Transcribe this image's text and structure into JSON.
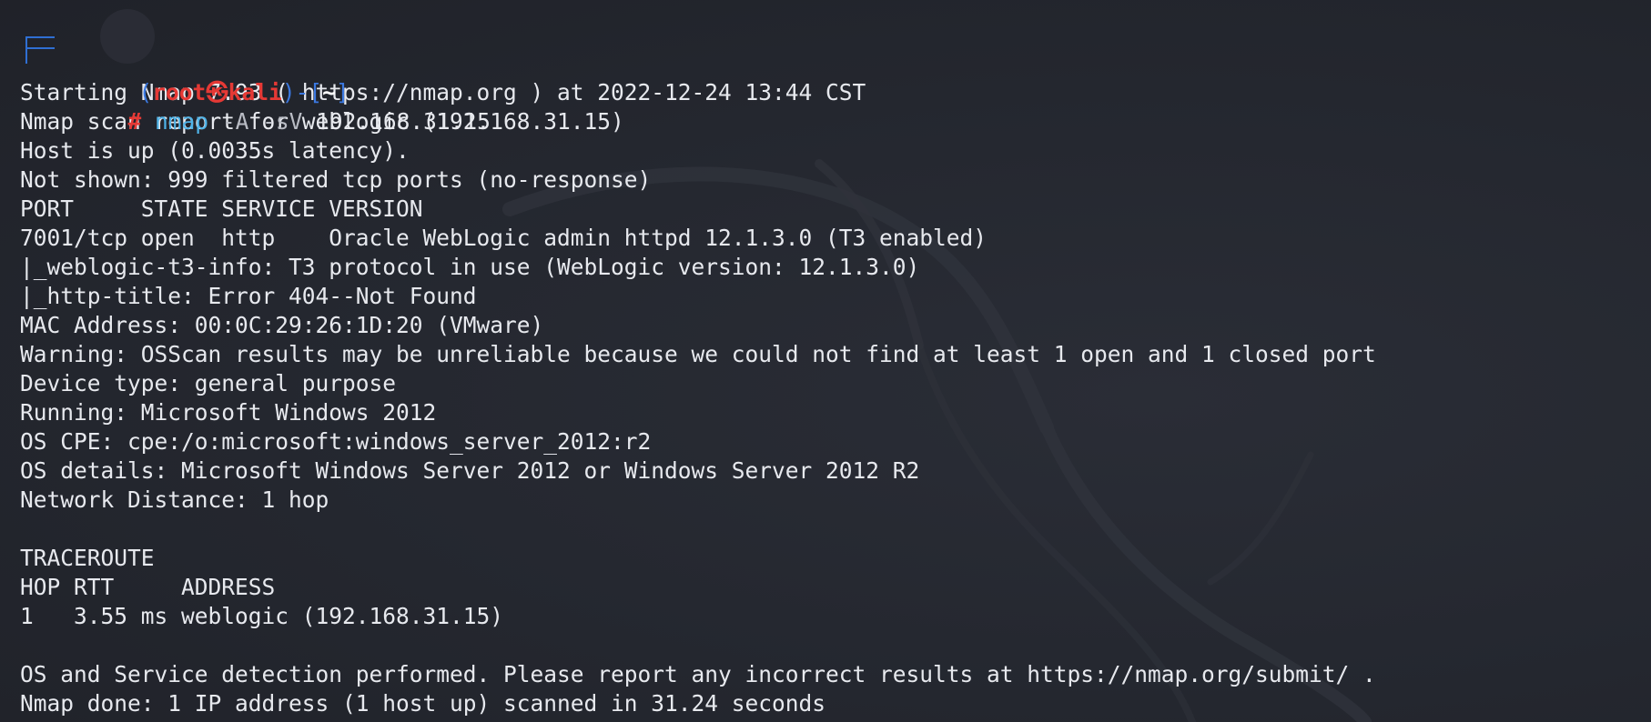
{
  "prompt": {
    "open_paren": "(",
    "user": "root",
    "at_symbol": "㉿",
    "host": "kali",
    "close_paren": ")",
    "dash": "-",
    "dir_open": "[",
    "dir": "~",
    "dir_close": "]",
    "hash": "#"
  },
  "command": {
    "program": "nmap",
    "flags": "-A -sV",
    "target": "192.168.31.15"
  },
  "output_lines": [
    "Starting Nmap 7.93 ( https://nmap.org ) at 2022-12-24 13:44 CST",
    "Nmap scan report for weblogic (192.168.31.15)",
    "Host is up (0.0035s latency).",
    "Not shown: 999 filtered tcp ports (no-response)",
    "PORT     STATE SERVICE VERSION",
    "7001/tcp open  http    Oracle WebLogic admin httpd 12.1.3.0 (T3 enabled)",
    "|_weblogic-t3-info: T3 protocol in use (WebLogic version: 12.1.3.0)",
    "|_http-title: Error 404--Not Found",
    "MAC Address: 00:0C:29:26:1D:20 (VMware)",
    "Warning: OSScan results may be unreliable because we could not find at least 1 open and 1 closed port",
    "Device type: general purpose",
    "Running: Microsoft Windows 2012",
    "OS CPE: cpe:/o:microsoft:windows_server_2012:r2",
    "OS details: Microsoft Windows Server 2012 or Windows Server 2012 R2",
    "Network Distance: 1 hop",
    "",
    "TRACEROUTE",
    "HOP RTT     ADDRESS",
    "1   3.55 ms weblogic (192.168.31.15)",
    "",
    "OS and Service detection performed. Please report any incorrect results at https://nmap.org/submit/ .",
    "Nmap done: 1 IP address (1 host up) scanned in 31.24 seconds"
  ],
  "colors": {
    "background": "#23262e",
    "text": "#e7e9ee",
    "prompt_frame": "#2f6fd3",
    "prompt_user": "#e53935",
    "command": "#4fb3e8"
  }
}
